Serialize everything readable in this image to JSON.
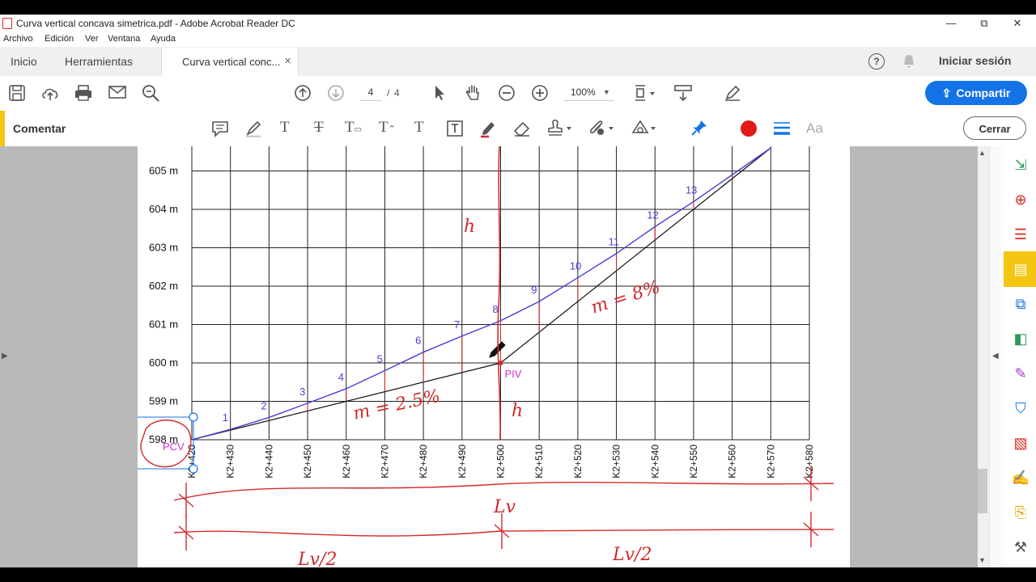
{
  "window": {
    "title": "Curva vertical concava simetrica.pdf - Adobe Acrobat Reader DC",
    "minimize": "—",
    "restore": "⧉",
    "close": "✕"
  },
  "menu": [
    "Archivo",
    "Edición",
    "Ver",
    "Ventana",
    "Ayuda"
  ],
  "tabs": {
    "home": "Inicio",
    "tools": "Herramientas",
    "document": "Curva vertical conc...",
    "document_close": "✕"
  },
  "header": {
    "help": "?",
    "signin": "Iniciar sesión"
  },
  "toolbar": {
    "page_current": "4",
    "page_sep": "/",
    "page_total": "4",
    "zoom": "100%",
    "share": "Compartir"
  },
  "comment": {
    "label": "Comentar",
    "close": "Cerrar",
    "text_tool": "Aa"
  },
  "colors": {
    "accent": "#1473e6",
    "comment_accent": "#f2c511",
    "curve": "#4a3fd6",
    "annotation": "#d22a2a",
    "piv": "#cc33cc"
  },
  "chart_data": {
    "type": "line",
    "ylabels": [
      "605 m",
      "604 m",
      "603 m",
      "602 m",
      "601 m",
      "600 m",
      "599 m",
      "598 m"
    ],
    "xlabels": [
      "K2+420",
      "K2+430",
      "K2+440",
      "K2+450",
      "K2+460",
      "K2+470",
      "K2+480",
      "K2+490",
      "K2+500",
      "K2+510",
      "K2+520",
      "K2+530",
      "K2+540",
      "K2+550",
      "K2+560",
      "K2+570",
      "K2+580"
    ],
    "x": [
      420,
      430,
      440,
      450,
      460,
      470,
      480,
      490,
      500,
      510,
      520,
      530,
      540,
      550,
      560,
      570
    ],
    "ylim": [
      597.8,
      605.5
    ],
    "xlim": [
      420,
      580
    ],
    "tangent_in": {
      "x": [
        420,
        500
      ],
      "y": [
        598.0,
        600.0
      ]
    },
    "tangent_out": {
      "x": [
        500,
        570
      ],
      "y": [
        600.0,
        605.6
      ]
    },
    "curve": {
      "x": [
        420,
        430,
        440,
        450,
        460,
        470,
        480,
        490,
        500,
        510,
        520,
        530,
        540,
        550,
        560,
        570
      ],
      "y": [
        598.0,
        598.27,
        598.58,
        598.95,
        599.33,
        599.8,
        600.28,
        600.7,
        601.1,
        601.6,
        602.22,
        602.85,
        603.55,
        604.2,
        604.9,
        605.6
      ]
    },
    "point_labels": [
      "1",
      "2",
      "3",
      "4",
      "5",
      "6",
      "7",
      "8",
      "9",
      "10",
      "11",
      "12",
      "13"
    ],
    "labels": {
      "pcv": "PCV",
      "piv": "PIV"
    },
    "handwriting": {
      "h_top": "h",
      "h_bottom": "h",
      "m_left": "m = 2.5%",
      "m_right": "m = 8%",
      "lv": "Lv",
      "lv_half_left": "Lv/2",
      "lv_half_right": "Lv/2"
    },
    "grid": true
  }
}
